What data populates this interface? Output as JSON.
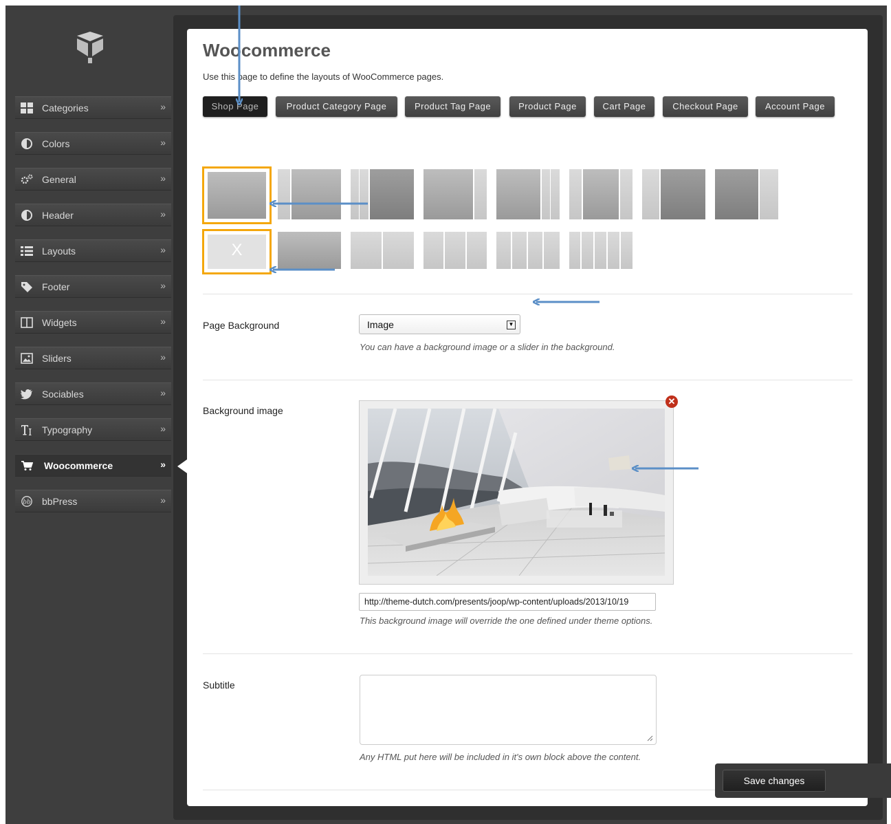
{
  "sidebar": {
    "items": [
      {
        "label": "Categories",
        "icon": "grid-icon"
      },
      {
        "label": "Colors",
        "icon": "contrast-icon"
      },
      {
        "label": "General",
        "icon": "gears-icon"
      },
      {
        "label": "Header",
        "icon": "contrast-icon"
      },
      {
        "label": "Layouts",
        "icon": "list-icon"
      },
      {
        "label": "Footer",
        "icon": "tag-icon"
      },
      {
        "label": "Widgets",
        "icon": "columns-icon"
      },
      {
        "label": "Sliders",
        "icon": "image-icon"
      },
      {
        "label": "Sociables",
        "icon": "twitter-bird-icon"
      },
      {
        "label": "Typography",
        "icon": "typography-icon"
      },
      {
        "label": "Woocommerce",
        "icon": "cart-icon"
      },
      {
        "label": "bbPress",
        "icon": "bbpress-icon"
      }
    ],
    "active": "Woocommerce",
    "chevron": "»"
  },
  "main": {
    "title": "Woocommerce",
    "description": "Use this page to define the layouts of WooCommerce pages.",
    "tabs": [
      "Shop Page",
      "Product Category Page",
      "Product Tag Page",
      "Product Page",
      "Cart Page",
      "Checkout Page",
      "Account Page"
    ],
    "selected_tab": "Shop Page",
    "no_sidebar_mark": "X",
    "page_background": {
      "label": "Page Background",
      "value": "Image",
      "help": "You can have a background image or a slider in the background."
    },
    "background_image": {
      "label": "Background image",
      "url": "http://theme-dutch.com/presents/joop/wp-content/uploads/2013/10/19",
      "help": "This background image will override the one defined under theme options.",
      "remove_mark": "✕"
    },
    "subtitle": {
      "label": "Subtitle",
      "value": "",
      "help": "Any HTML put here will be included in it's own block above the content."
    }
  },
  "footer": {
    "save_label": "Save changes"
  },
  "colors": {
    "accent": "#f4a70c",
    "annotation_arrow": "#5b8fc7",
    "remove": "#c0301b"
  }
}
